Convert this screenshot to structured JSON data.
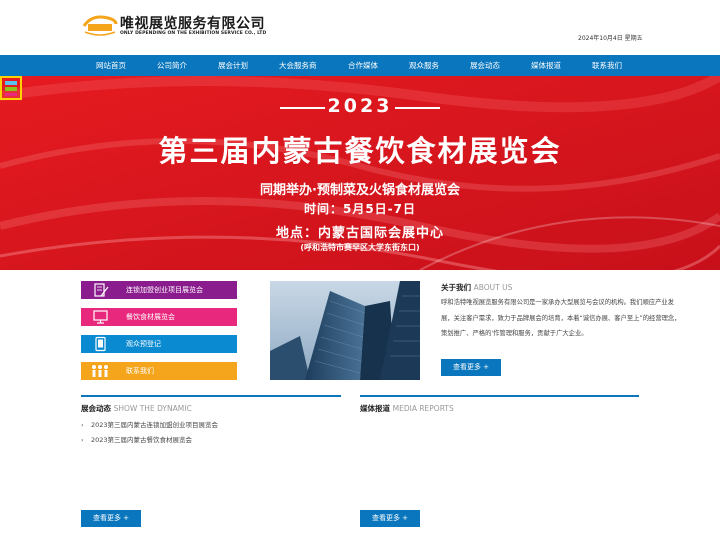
{
  "header": {
    "company_name": "唯视展览服务有限公司",
    "company_sub": "ONLY DEPENDING ON THE EXHIBITION SERVICE CO., LTD",
    "date": "2024年10月4日 星期五"
  },
  "nav": {
    "items": [
      "网站首页",
      "公司简介",
      "展会计划",
      "大会服务商",
      "合作媒体",
      "观众服务",
      "展会动态",
      "媒体报道",
      "联系我们"
    ]
  },
  "banner": {
    "year": "2023",
    "title": "第三届内蒙古餐饮食材展览会",
    "subtitle": "同期举办·预制菜及火锅食材展览会",
    "time": "时间：5月5日-7日",
    "location": "地点：内蒙古国际会展中心",
    "address": "(呼和浩特市赛罕区大学东街东口)"
  },
  "menu": {
    "items": [
      {
        "label": "连锁加盟创业项目展览会",
        "color": "#8a1c8d",
        "icon": "document-pen-icon"
      },
      {
        "label": "餐饮食材展览会",
        "color": "#e8287d",
        "icon": "monitor-icon"
      },
      {
        "label": "观众预登记",
        "color": "#0a8ad0",
        "icon": "tablet-icon"
      },
      {
        "label": "联系我们",
        "color": "#f5a51c",
        "icon": "people-icon"
      }
    ]
  },
  "about": {
    "title": "关于我们",
    "title_en": "ABOUT US",
    "text": "呼和浩特唯视展览服务有限公司是一家承办大型展览与会议的机构。我们顺应产业发展，关注客户需求，致力于品牌展会的培育，本着“诚信办展、客户至上”的经营理念，策划推广、严格的'作管理和服务，贡献于广大企业。",
    "more": "查看更多  +"
  },
  "news": {
    "title": "展会动态",
    "title_en": "SHOW THE DYNAMIC",
    "items": [
      "2023第三届内蒙古连锁加盟创业项目展览会",
      "2023第三届内蒙古餐饮食材展览会"
    ],
    "more": "查看更多  +"
  },
  "media": {
    "title": "媒体报道",
    "title_en": "MEDIA REPORTS",
    "more": "查看更多  +"
  },
  "colors": {
    "nav_blue": "#0a76bd",
    "banner_red": "#d8141c"
  }
}
